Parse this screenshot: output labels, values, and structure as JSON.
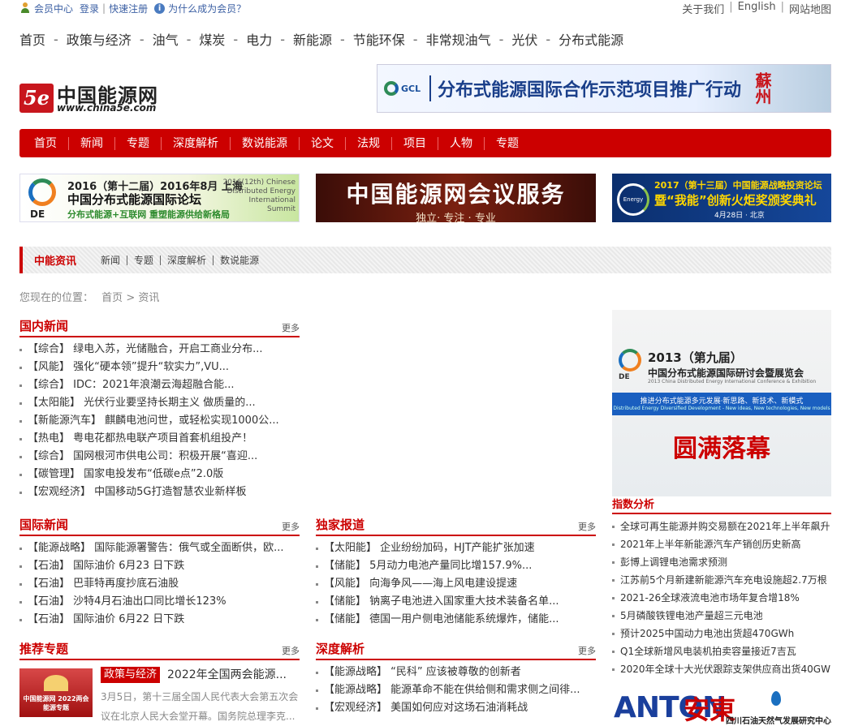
{
  "topbar": {
    "member_center": "会员中心",
    "login": "登录",
    "quick_register": "快速注册",
    "why_member": "为什么成为会员？",
    "about": "关于我们",
    "english": "English",
    "sitemap": "网站地图"
  },
  "primary_nav": [
    "首页",
    "政策与经济",
    "油气",
    "煤炭",
    "电力",
    "新能源",
    "节能环保",
    "非常规油气",
    "光伏",
    "分布式能源"
  ],
  "logo": {
    "mark": "5e",
    "cn": "中国能源网",
    "en": "www.china5e.com"
  },
  "banner_top": {
    "brand": "GCL",
    "text": "分布式能源国际合作示范项目推广行动",
    "city": "蘇州"
  },
  "red_nav": [
    "首页",
    "新闻",
    "专题",
    "深度解析",
    "数说能源",
    "论文",
    "法规",
    "项目",
    "人物",
    "专题"
  ],
  "banners": {
    "b1": {
      "de": "DE",
      "l1": "2016（第十二届）2016年8月 上海",
      "l2": "中国分布式能源国际论坛",
      "l3": "分布式能源+互联网 重塑能源供给新格局",
      "right": "2016(12th) Chinese Distributed Energy International Summit"
    },
    "b2": {
      "l1": "中国能源网会议服务",
      "l2": "独立· 专注 · 专业"
    },
    "b3": {
      "ring": "Energy",
      "l1": "2017（第十三届）中国能源战略投资论坛",
      "l2": "暨“我能”创新火炬奖颁奖典礼",
      "l3": "4月28日 · 北京"
    }
  },
  "tabbar": {
    "active": "中能资讯",
    "tabs": [
      "新闻",
      "专题",
      "深度解析",
      "数说能源"
    ]
  },
  "breadcrumb": {
    "label": "您现在的位置：",
    "home": "首页",
    "arrow": ">",
    "current": "资讯"
  },
  "more_label": "更多",
  "domestic": {
    "title": "国内新闻",
    "items": [
      "【综合】 绿电入苏，光储融合，开启工商业分布...",
      "【风能】 强化“硬本领”提升“软实力”,VU...",
      "【综合】 IDC：2021年浪潮云海超融合能...",
      "【太阳能】 光伏行业要坚持长期主义 做质量的...",
      "【新能源汽车】 麒麟电池问世，或轻松实现1000公...",
      "【热电】 粤电花都热电联产项目首套机组投产！",
      "【综合】 国网根河市供电公司：积极开展“喜迎...",
      "【碳管理】 国家电投发布“低碳e点”2.0版",
      "【宏观经济】 中国移动5G打造智慧农业新样板"
    ]
  },
  "international": {
    "title": "国际新闻",
    "items": [
      "【能源战略】 国际能源署警告：俄气或全面断供，欧...",
      "【石油】 国际油价 6月23 日下跌",
      "【石油】 巴菲特再度抄底石油股",
      "【石油】 沙特4月石油出口同比增长123%",
      "【石油】 国际油价 6月22 日下跌"
    ]
  },
  "exclusive": {
    "title": "独家报道",
    "items": [
      "【太阳能】 企业纷纷加码，HJT产能扩张加速",
      "【储能】 5月动力电池产量同比增157.9%...",
      "【风能】 向海争风——海上风电建设提速",
      "【储能】 钠离子电池进入国家重大技术装备名单...",
      "【储能】 德国一用户侧电池储能系统爆炸，储能..."
    ]
  },
  "recommended": {
    "title": "推荐专题",
    "image_caption": "中国能源网 2022两会能源专题",
    "tag": "政策与经济",
    "headline": "2022年全国两会能源...",
    "desc": "3月5日，第十三届全国人民代表大会第五次会议在北京人民大会堂开幕。国务院总理李克..."
  },
  "deep": {
    "title": "深度解析",
    "items": [
      "【能源战略】 “民科” 应该被尊敬的创新者",
      "【能源战略】 能源革命不能在供给侧和需求侧之间徘...",
      "【宏观经济】 美国如何应对这场石油消耗战"
    ]
  },
  "right_ad": {
    "de": "DE",
    "l1": "2013（第九届）",
    "l2": "中国分布式能源国际研讨会暨展览会",
    "l3": "2013 China Distributed Energy International Conference & Exhibition",
    "strip": "推进分布式能源多元发展·新思路、新技术、新模式",
    "strip_en": "Distributed Energy Diversified Development - New ideas, New technologies, New models",
    "big": "圆满落幕"
  },
  "index_analysis": {
    "title": "指数分析",
    "items": [
      "全球可再生能源并购交易额在2021年上半年飙升",
      "2021年上半年新能源汽车产销创历史新高",
      "彭博上调锂电池需求预测",
      "江苏前5个月新建新能源汽车充电设施超2.7万根",
      "2021-26全球液流电池市场年复合增18%",
      "5月磷酸铁锂电池产量超三元电池",
      "预计2025中国动力电池出货超470GWh",
      "Q1全球新增风电装机拍卖容量接近7吉瓦",
      "2020年全球十大光伏跟踪支架供应商出货40GW"
    ]
  },
  "anton": {
    "en": "ANTON",
    "cn": "安東",
    "org": "四川石油天然气发展研究中心"
  }
}
